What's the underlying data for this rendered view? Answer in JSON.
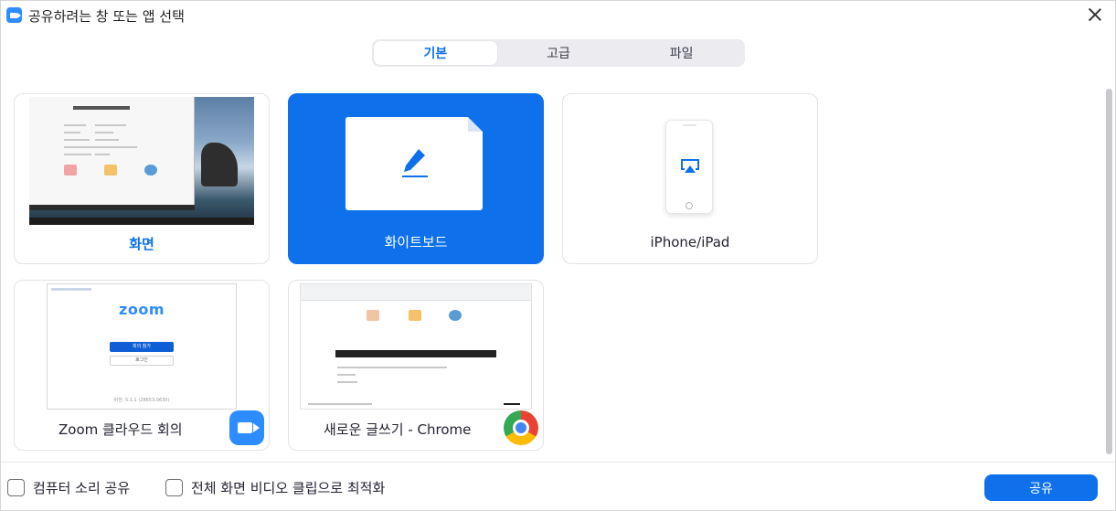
{
  "window": {
    "title": "공유하려는 창 또는 앱 선택",
    "close_icon": "close-icon"
  },
  "tabs": [
    {
      "label": "기본",
      "active": true
    },
    {
      "label": "고급",
      "active": false
    },
    {
      "label": "파일",
      "active": false
    }
  ],
  "cards": {
    "screen": {
      "label": "화면",
      "selected": false
    },
    "whiteboard": {
      "label": "화이트보드",
      "selected": true,
      "icon": "pencil-icon"
    },
    "iphone": {
      "label": "iPhone/iPad",
      "icon": "airplay-icon"
    },
    "zoom": {
      "label": "Zoom 클라우드 회의",
      "thumb_logo": "zoom",
      "thumb_join": "회의 참가",
      "thumb_signin": "로그인",
      "thumb_version": "버전: 5.1.1 (28653.0630)",
      "badge": "zoom-app-icon"
    },
    "chrome": {
      "label": "새로운 글쓰기 - Chrome",
      "badge": "chrome-icon"
    }
  },
  "footer": {
    "computer_sound": {
      "label": "컴퓨터 소리 공유",
      "checked": false
    },
    "optimize_video": {
      "label": "전체 화면 비디오 클립으로 최적화",
      "checked": false
    },
    "share_button": "공유"
  },
  "colors": {
    "accent": "#0e71eb",
    "zoom_blue": "#2d8cff",
    "tab_bg": "#ebebf0"
  }
}
